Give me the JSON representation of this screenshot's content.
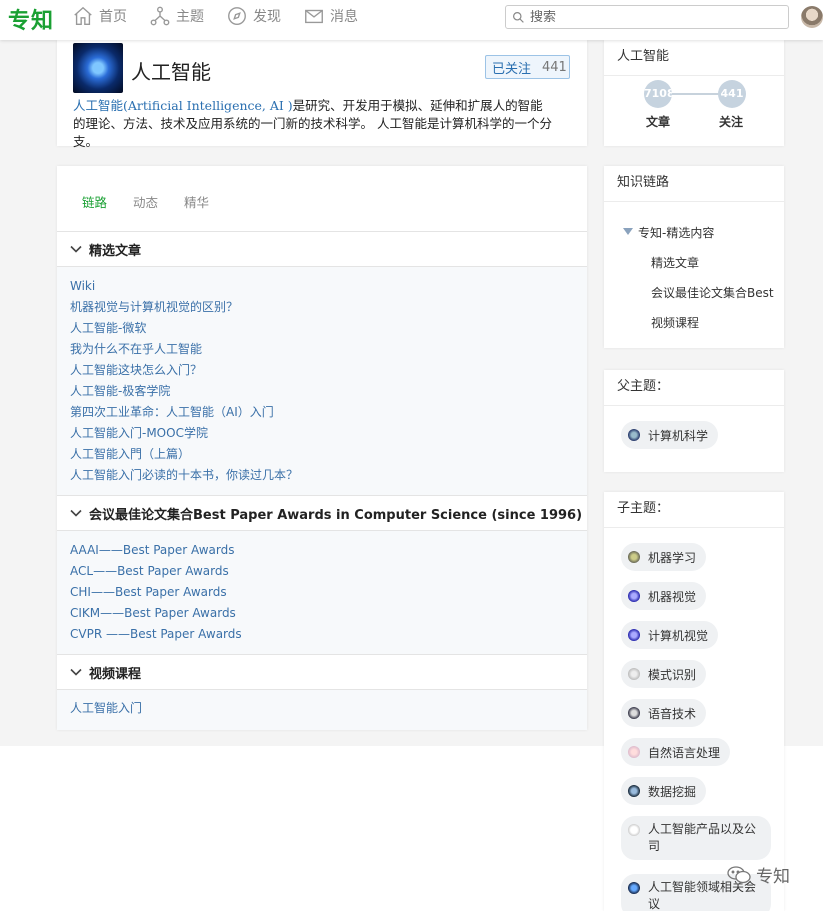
{
  "app": {
    "logo": "专知"
  },
  "nav": [
    {
      "label": "首页",
      "icon": "home-icon"
    },
    {
      "label": "主题",
      "icon": "topic-icon"
    },
    {
      "label": "发现",
      "icon": "compass-icon"
    },
    {
      "label": "消息",
      "icon": "mail-icon"
    }
  ],
  "search": {
    "placeholder": "搜索"
  },
  "topic": {
    "title": "人工智能",
    "follow_label": "已关注",
    "follow_count": "441",
    "desc_link": "人工智能(Artificial Intelligence, AI )",
    "desc_text": "是研究、开发用于模拟、延伸和扩展人的智能的理论、方法、技术及应用系统的一门新的技术科学。 人工智能是计算机科学的一个分支。"
  },
  "tabs": [
    {
      "label": "链路",
      "active": true
    },
    {
      "label": "动态",
      "active": false
    },
    {
      "label": "精华",
      "active": false
    }
  ],
  "sections": [
    {
      "title": "精选文章",
      "items": [
        "Wiki",
        "机器视觉与计算机视觉的区别？",
        "人工智能-微软",
        "我为什么不在乎人工智能",
        "人工智能这块怎么入门？",
        "人工智能-极客学院",
        "第四次工业革命：人工智能（AI）入门",
        "人工智能入门-MOOC学院",
        "人工智能入門（上篇）",
        "人工智能入门必读的十本书，你读过几本？"
      ]
    },
    {
      "title": "会议最佳论文集合Best Paper Awards in Computer Science (since 1996)",
      "items": [
        "AAAI——Best Paper Awards",
        "ACL——Best Paper Awards",
        "CHI——Best Paper Awards",
        "CIKM——Best Paper Awards",
        "CVPR ——Best Paper Awards"
      ]
    },
    {
      "title": "视频课程",
      "items": [
        "人工智能入门"
      ]
    }
  ],
  "sidebar": {
    "stats_title": "人工智能",
    "articles_count": "7108",
    "articles_label": "文章",
    "follow_count": "441",
    "follow_label": "关注",
    "chain_title": "知识链路",
    "chain_root": "专知-精选内容",
    "chain_items": [
      "精选文章",
      "会议最佳论文集合Best",
      "视频课程"
    ],
    "parent_title": "父主题：",
    "parent_topics": [
      "计算机科学"
    ],
    "child_title": "子主题：",
    "child_topics": [
      "机器学习",
      "机器视觉",
      "计算机视觉",
      "模式识别",
      "语音技术",
      "自然语言处理",
      "数据挖掘",
      "人工智能产品以及公司",
      "人工智能领域相关会议"
    ]
  },
  "watermark": "专知",
  "colors": {
    "brand": "#1aa033",
    "link": "#3a70a8",
    "follow_bg": "#eef5fc"
  }
}
